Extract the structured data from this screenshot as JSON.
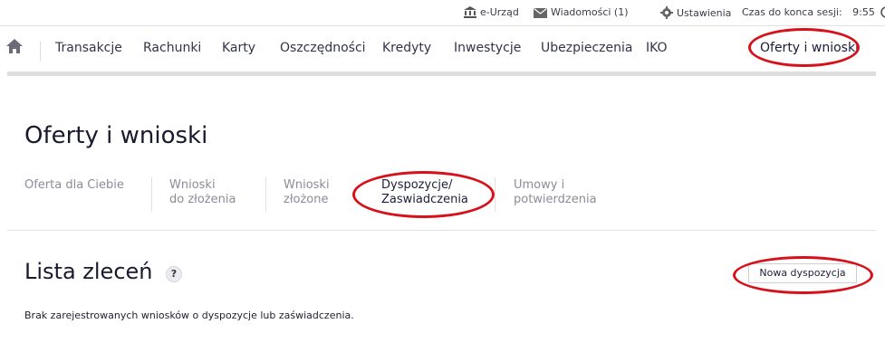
{
  "topbar": {
    "eurzad": "e-Urząd",
    "wiadomosci": "Wiadomości (1)",
    "ustawienia": "Ustawienia",
    "session_label": "Czas do konca sesji:",
    "session_time": "9:55"
  },
  "nav": {
    "items": [
      "Transakcje",
      "Rachunki",
      "Karty",
      "Oszczędności",
      "Kredyty",
      "Inwestycje",
      "Ubezpieczenia",
      "IKO"
    ],
    "active": "Oferty i wnioski"
  },
  "page": {
    "title": "Oferty i wnioski"
  },
  "subtabs": [
    {
      "line1": "Oferta dla Ciebie",
      "line2": ""
    },
    {
      "line1": "Wnioski",
      "line2": "do złożenia"
    },
    {
      "line1": "Wnioski",
      "line2": "złożone"
    },
    {
      "line1": "Dyspozycje/",
      "line2": "Zaswiadczenia"
    },
    {
      "line1": "Umowy i",
      "line2": "potwierdzenia"
    }
  ],
  "list": {
    "title": "Lista zleceń",
    "help": "?",
    "new_button": "Nowa dyspozycja",
    "empty_message": "Brak zarejestrowanych wniosków o dyspozycje lub zaświadczenia."
  },
  "colors": {
    "annotation": "#d8101a",
    "text_dark": "#1a1a2e",
    "text_muted": "#8c8c99"
  }
}
